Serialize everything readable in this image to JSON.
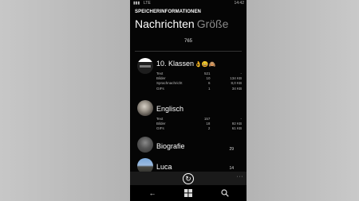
{
  "status_bar": {
    "time": "14:42",
    "signal": "LTE"
  },
  "header": {
    "title": "SPEICHERINFORMATIONEN"
  },
  "pivot": {
    "active": "Nachrichten",
    "inactive": "Größe"
  },
  "total_count": "765",
  "chats": [
    {
      "name": "10. Klassen",
      "emoji": "👌😀🙈",
      "details": [
        [
          "Text",
          "521",
          "-"
        ],
        [
          "Bilder",
          "10",
          "134 KB"
        ],
        [
          "Sprachnachricht",
          "6",
          "8,0 KB"
        ],
        [
          "GIFs",
          "1",
          "34 KB"
        ]
      ]
    },
    {
      "name": "Englisch",
      "details": [
        [
          "Text",
          "157",
          "-"
        ],
        [
          "Bilder",
          "18",
          "92 KB"
        ],
        [
          "GIFs",
          "2",
          "61 KB"
        ]
      ]
    },
    {
      "name": "Biografie",
      "badge": "29"
    },
    {
      "name": "Luca",
      "badge": "14"
    }
  ],
  "app_bar": {
    "more": "···"
  }
}
